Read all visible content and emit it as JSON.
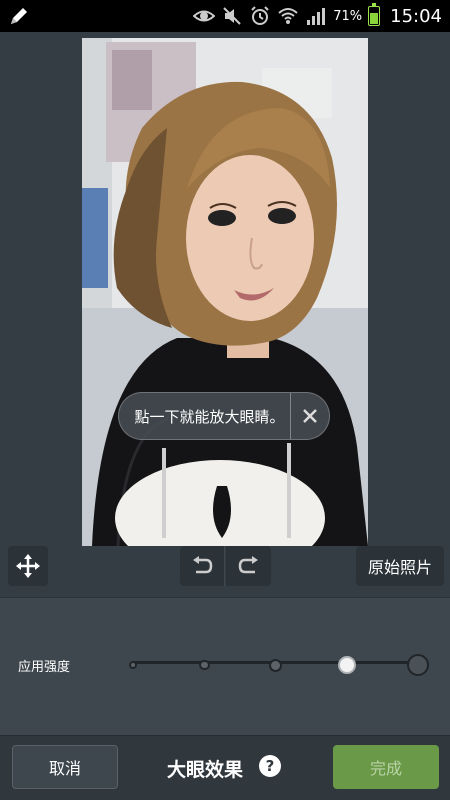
{
  "status_bar": {
    "battery_percent": "71%",
    "battery_level": 0.71,
    "time": "15:04",
    "icons": [
      "pencil-icon",
      "eye-icon",
      "mute-icon",
      "alarm-icon",
      "wifi-icon",
      "signal-icon",
      "battery-icon"
    ]
  },
  "editor": {
    "toast_message": "點一下就能放大眼睛。",
    "original_photo_label": "原始照片"
  },
  "strength": {
    "label": "应用强度",
    "levels": 5,
    "selected_level": 4
  },
  "bottom_bar": {
    "cancel_label": "取消",
    "title": "大眼效果",
    "help_label": "?",
    "done_label": "完成"
  },
  "colors": {
    "accent_green": "#6a9a47",
    "background": "#3a4249"
  }
}
